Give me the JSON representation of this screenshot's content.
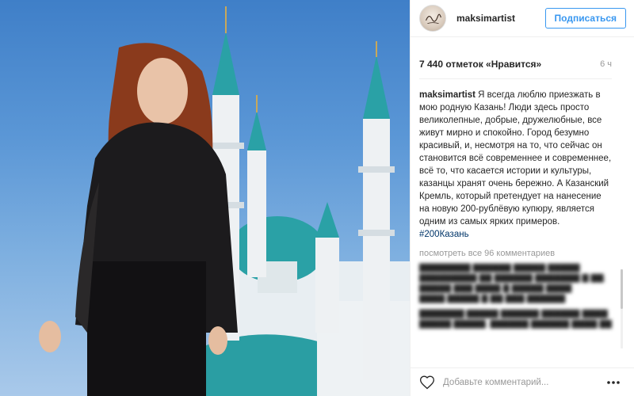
{
  "post": {
    "photo_icon": "post-photo"
  },
  "header": {
    "username": "maksimartist",
    "follow_label": "Подписаться"
  },
  "stats": {
    "likes": "7 440 отметок «Нравится»",
    "time": "6 ч"
  },
  "caption": {
    "user": "maksimartist",
    "text": "Я всегда люблю приезжать в мою родную Казань! Люди здесь просто великолепные, добрые, дружелюбные, все живут мирно и спокойно. Город безумно красивый, и, несмотря на то, что сейчас он становится всё современнее и современнее, всё то, что касается истории и культуры, казанцы хранят очень бережно. А Казанский Кремль, который претендует на нанесение на новую 200-рублёвую купюру, является одним из самых ярких примеров.",
    "hashtag": "#200Казань"
  },
  "comments": {
    "view_all": "посмотреть все 96 комментариев"
  },
  "footer": {
    "comment_placeholder": "Добавьте комментарий...",
    "heart_icon": "heart-icon",
    "more_icon": "more-icon"
  },
  "colors": {
    "accent": "#3897f0",
    "hashtag": "#003569",
    "muted": "#999999"
  }
}
